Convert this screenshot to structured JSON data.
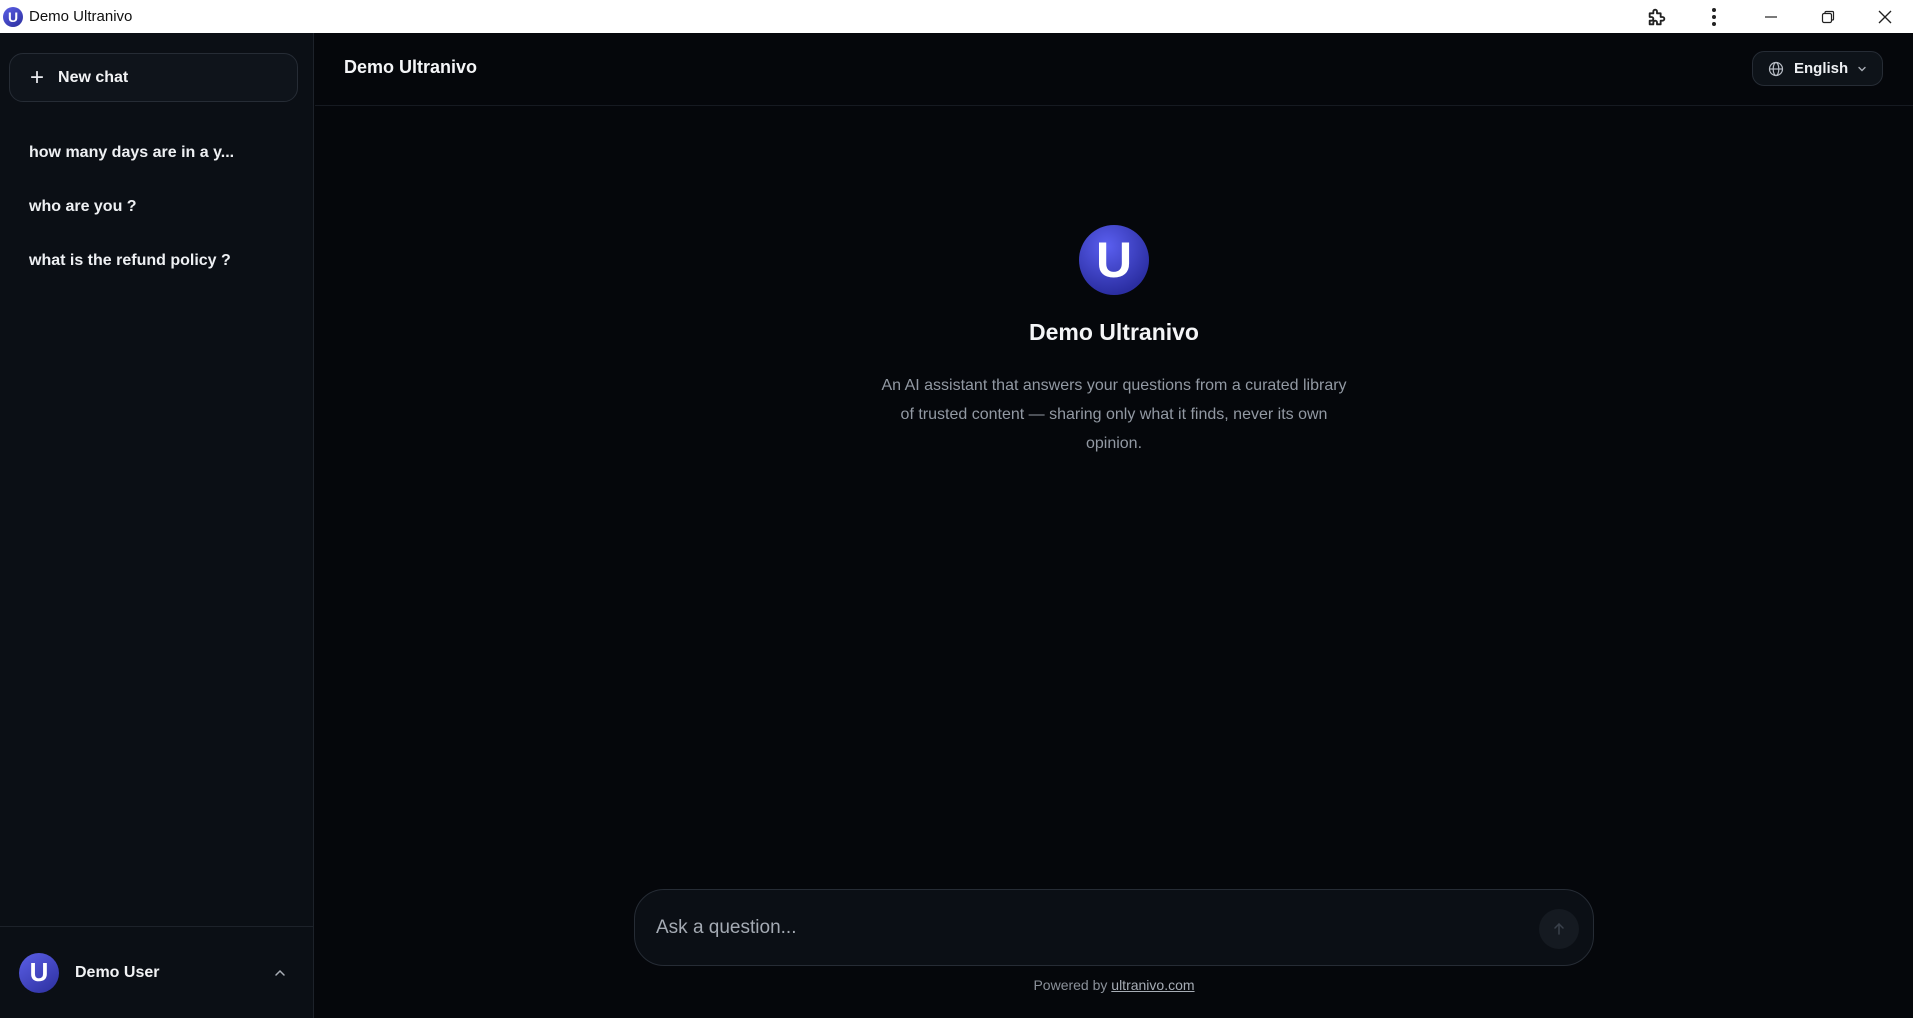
{
  "window": {
    "title": "Demo Ultranivo",
    "logo_letter": "U"
  },
  "sidebar": {
    "new_chat_label": "New chat",
    "history": [
      {
        "label": "how many days are in a y..."
      },
      {
        "label": "who are you ?"
      },
      {
        "label": "what is the refund policy ?"
      }
    ],
    "user": {
      "name": "Demo User",
      "avatar_letter": "U"
    }
  },
  "header": {
    "title": "Demo Ultranivo",
    "language": "English"
  },
  "hero": {
    "logo_letter": "U",
    "title": "Demo Ultranivo",
    "description": "An AI assistant that answers your questions from a curated library of trusted content — sharing only what it finds, never its own opinion."
  },
  "composer": {
    "placeholder": "Ask a question...",
    "value": ""
  },
  "footer": {
    "powered_prefix": "Powered by ",
    "powered_link": "ultranivo.com"
  },
  "colors": {
    "background": "#05070b",
    "sidebar": "#0b0f15",
    "brand": "#3b3fd0"
  },
  "icons": [
    "extension-icon",
    "kebab-menu-icon",
    "minimize-icon",
    "restore-icon",
    "close-icon",
    "plus-icon",
    "globe-icon",
    "chevron-down-icon",
    "chevron-up-icon",
    "arrow-up-icon"
  ]
}
